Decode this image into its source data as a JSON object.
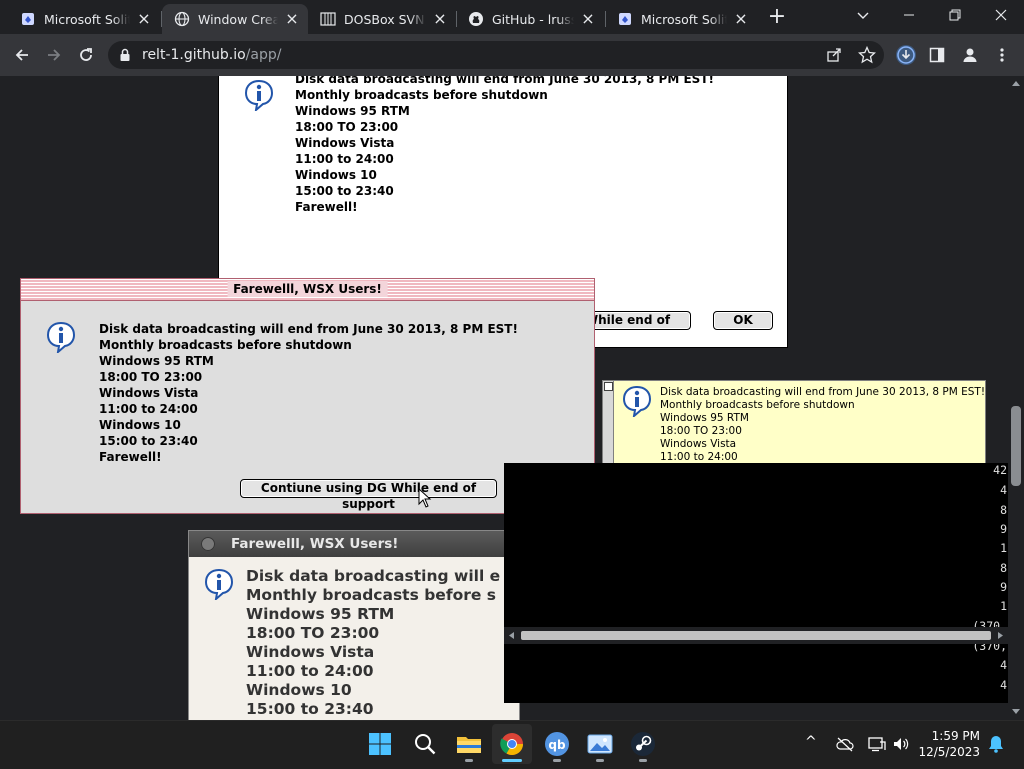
{
  "browser": {
    "tabs": [
      {
        "title": "Microsoft Solitaire",
        "icon": "solitaire-icon",
        "active": false
      },
      {
        "title": "Window Creator",
        "icon": "globe-icon",
        "active": true
      },
      {
        "title": "DOSBox SVN, CPU",
        "icon": "columns-icon",
        "active": false
      },
      {
        "title": "GitHub - lrusso",
        "icon": "github-icon",
        "active": false
      },
      {
        "title": "Microsoft Solitaire",
        "icon": "solitaire-icon",
        "active": false
      }
    ],
    "url_host": "relt-1.github.io",
    "url_path": "/app/",
    "new_tab": "+",
    "tab_close": "×"
  },
  "dialog_message": {
    "line1": "Disk data broadcasting will end from June 30 2013, 8 PM EST!",
    "line2": "Monthly broadcasts before shutdown",
    "line3": "Windows 95 RTM",
    "line4": "18:00 TO 23:00",
    "line5": "Windows Vista",
    "line6": "11:00 to 24:00",
    "line7": "Windows 10",
    "line8": "15:00 to 23:40",
    "line9": "Farewell!"
  },
  "dialog_message_trunc": {
    "line1": "Disk data broadcasting will e",
    "line2": "Monthly broadcasts before s"
  },
  "dialog_title": "Farewelll, WSX Users!",
  "buttons": {
    "continue": "Contiune using DG While end of support",
    "ok": "OK"
  },
  "terminal_lines": [
    "42",
    "4",
    "8",
    "9",
    "1",
    "8",
    "9",
    "1",
    "(370,",
    "(370,",
    "4",
    "4"
  ],
  "taskbar": {
    "apps": [
      "start-icon",
      "search-icon",
      "file-explorer-icon",
      "chrome-icon",
      "qbittorrent-icon",
      "photos-icon",
      "steam-icon"
    ],
    "time": "1:59 PM",
    "date": "12/5/2023",
    "tray_arrow": "^"
  },
  "colors": {
    "chrome_dark": "#202124",
    "toolbar": "#35363a",
    "pink_dialog_border": "#b06070",
    "yellow_dialog": "#ffffc8",
    "info_blue": "#2255aa"
  }
}
